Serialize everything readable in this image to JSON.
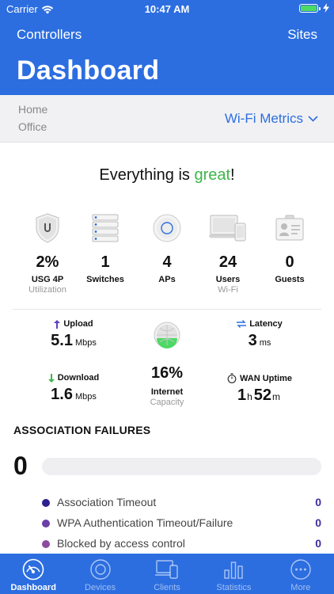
{
  "status_bar": {
    "carrier": "Carrier",
    "time": "10:47 AM"
  },
  "header": {
    "left_button": "Controllers",
    "right_button": "Sites",
    "title": "Dashboard"
  },
  "site": {
    "line1": "Home",
    "line2": "Office",
    "metrics_select": "Wi-Fi Metrics"
  },
  "headline": {
    "prefix": "Everything is ",
    "highlight": "great",
    "suffix": "!"
  },
  "devices": [
    {
      "icon": "shield-icon",
      "value": "2%",
      "label": "USG 4P",
      "sub": "Utilization"
    },
    {
      "icon": "switch-icon",
      "value": "1",
      "label": "Switches",
      "sub": ""
    },
    {
      "icon": "access-point-icon",
      "value": "4",
      "label": "APs",
      "sub": ""
    },
    {
      "icon": "devices-icon",
      "value": "24",
      "label": "Users",
      "sub": "Wi-Fi"
    },
    {
      "icon": "guest-badge-icon",
      "value": "0",
      "label": "Guests",
      "sub": ""
    }
  ],
  "throughput": {
    "upload": {
      "label": "Upload",
      "value": "5.1",
      "unit": "Mbps"
    },
    "download": {
      "label": "Download",
      "value": "1.6",
      "unit": "Mbps"
    },
    "latency": {
      "label": "Latency",
      "value": "3",
      "unit": "ms"
    },
    "uptime": {
      "label": "WAN Uptime",
      "hours": "1",
      "hours_unit": "h",
      "minutes": "52",
      "minutes_unit": "m"
    },
    "internet": {
      "value": "16%",
      "label": "Internet",
      "sub": "Capacity"
    }
  },
  "association_failures": {
    "title": "ASSOCIATION FAILURES",
    "count": "0",
    "items": [
      {
        "label": "Association Timeout",
        "value": "0",
        "color": "#2b1f8f"
      },
      {
        "label": "WPA Authentication Timeout/Failure",
        "value": "0",
        "color": "#6b3fa8"
      },
      {
        "label": "Blocked by access control",
        "value": "0",
        "color": "#8b4c9e"
      }
    ]
  },
  "tabs": [
    {
      "label": "Dashboard",
      "icon": "dashboard-gauge-icon",
      "active": true
    },
    {
      "label": "Devices",
      "icon": "devices-disc-icon",
      "active": false
    },
    {
      "label": "Clients",
      "icon": "clients-icon",
      "active": false
    },
    {
      "label": "Statistics",
      "icon": "statistics-icon",
      "active": false
    },
    {
      "label": "More",
      "icon": "more-icon",
      "active": false
    }
  ],
  "colors": {
    "brand_blue": "#2c6ee0",
    "great_green": "#3cb54a",
    "value_purple": "#3a2d9e"
  }
}
